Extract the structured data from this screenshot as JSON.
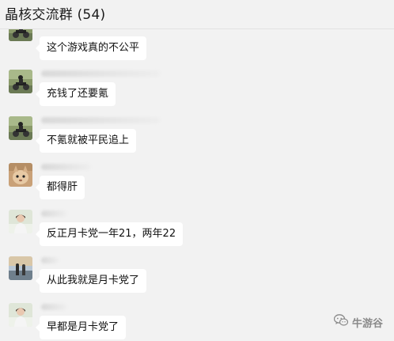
{
  "header": {
    "title": "晶核交流群 (54)"
  },
  "messages": [
    {
      "text": "这个游戏真的不公平",
      "avatar": "motorcycle-rider-avatar"
    },
    {
      "text": "充钱了还要氪",
      "avatar": "motorcycle-rider-avatar"
    },
    {
      "text": "不氪就被平民追上",
      "avatar": "motorcycle-rider-avatar"
    },
    {
      "text": "都得肝",
      "avatar": "cat-avatar"
    },
    {
      "text": "反正月卡党一年21，两年22",
      "avatar": "person-avatar"
    },
    {
      "text": "从此我就是月卡党了",
      "avatar": "beach-couple-avatar"
    },
    {
      "text": "早都是月卡党了",
      "avatar": "person-avatar"
    }
  ],
  "watermark": {
    "text": "牛游谷",
    "icon": "wechat-icon"
  },
  "colors": {
    "background": "#f2f2f2",
    "bubble": "#ffffff",
    "text": "#111111",
    "watermark": "#8a8a8a"
  }
}
